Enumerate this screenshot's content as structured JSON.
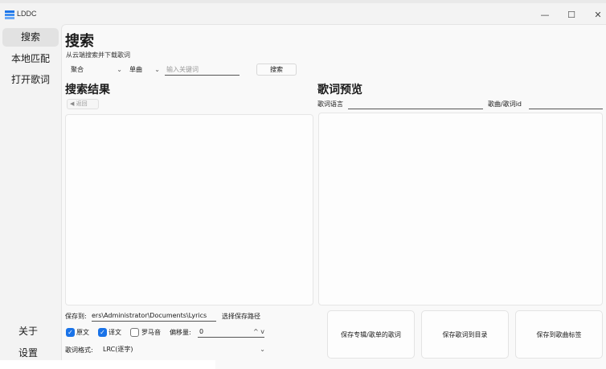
{
  "window": {
    "title": "LDDC",
    "minimize_glyph": "—",
    "maximize_glyph": "☐",
    "close_glyph": "✕",
    "accent": "#1a73e8"
  },
  "sidebar": {
    "items": [
      {
        "label": "搜索",
        "active": true
      },
      {
        "label": "本地匹配"
      },
      {
        "label": "打开歌词"
      }
    ],
    "bottom_items": [
      {
        "label": "关于"
      },
      {
        "label": "设置"
      }
    ]
  },
  "search": {
    "title": "搜索",
    "subtitle": "从云端搜索并下载歌词",
    "source_value": "聚合",
    "type_value": "单曲",
    "input_placeholder": "输入关键词",
    "search_button": "搜索"
  },
  "results": {
    "title": "搜索结果",
    "back_button": "返回",
    "back_icon": "◀"
  },
  "preview": {
    "title": "歌词预览",
    "language_label": "歌词语言",
    "song_id_label": "歌曲/歌词id"
  },
  "save": {
    "save_to_label": "保存到:",
    "path_value": "ers\\Administrator\\Documents\\Lyrics",
    "choose_path_button": "选择保存路径",
    "original_label": "原文",
    "translation_label": "译文",
    "romanization_label": "罗马音",
    "original_checked": true,
    "translation_checked": true,
    "romanization_checked": false,
    "offset_label": "偏移量:",
    "offset_value": "0",
    "stepper_glyph": "^ v",
    "format_label": "歌词格式:",
    "format_value": "LRC(逐字)"
  },
  "actions": {
    "save_album_playlist": "保存专辑/歌单的歌词",
    "save_to_dir": "保存歌词到目录",
    "save_to_tag": "保存到歌曲标签"
  },
  "icons": {
    "check": "✓",
    "chevron": "⌄"
  }
}
